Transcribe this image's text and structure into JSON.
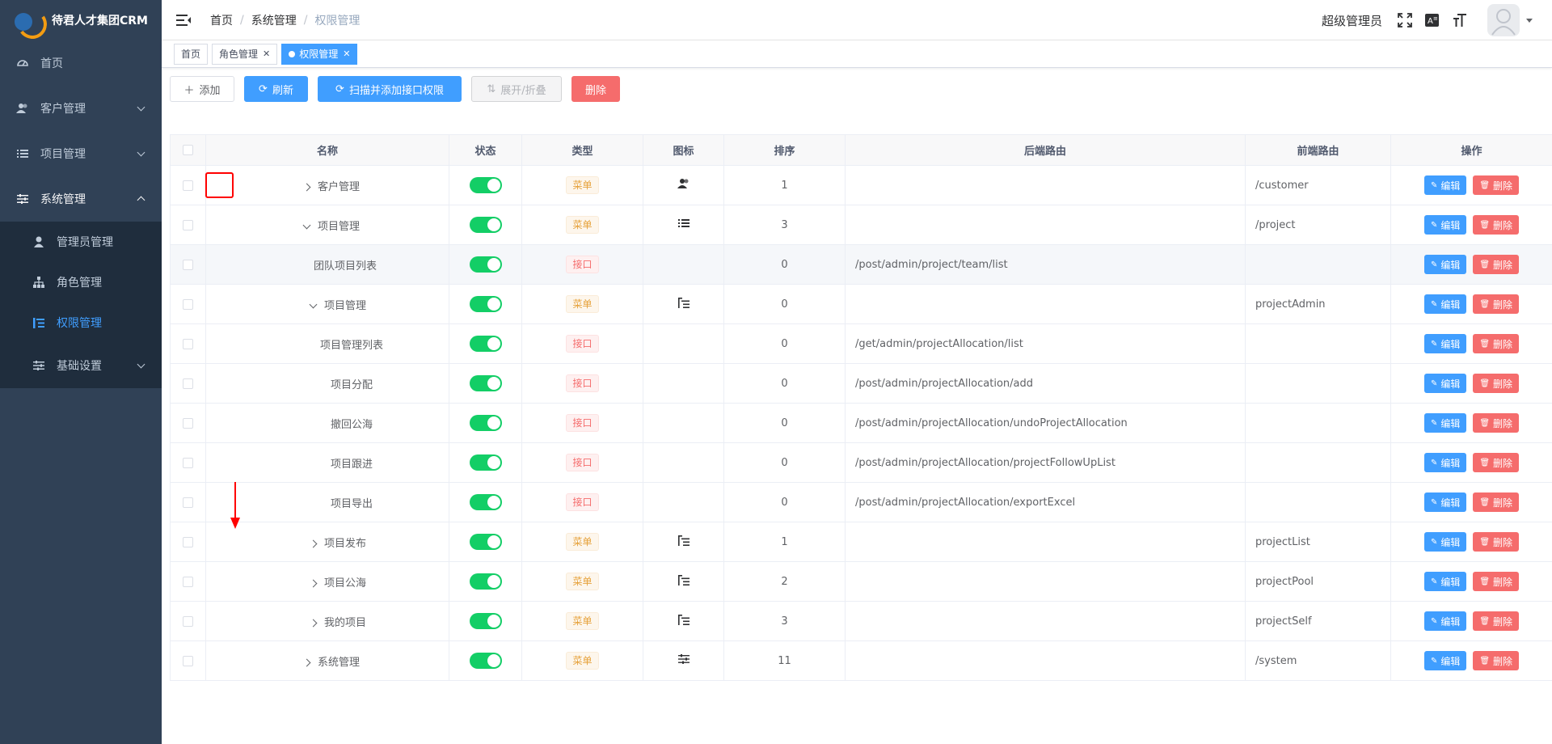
{
  "app": {
    "title": "待君人才集团CRM"
  },
  "sidebar": {
    "items": [
      {
        "label": "首页",
        "icon": "dashboard-icon"
      },
      {
        "label": "客户管理",
        "icon": "users-icon"
      },
      {
        "label": "项目管理",
        "icon": "list-icon"
      },
      {
        "label": "系统管理",
        "icon": "sliders-icon"
      }
    ],
    "submenu": [
      {
        "label": "管理员管理",
        "icon": "user-icon"
      },
      {
        "label": "角色管理",
        "icon": "sitemap-icon"
      },
      {
        "label": "权限管理",
        "icon": "tree-list-icon",
        "active": true
      },
      {
        "label": "基础设置",
        "icon": "sliders-icon"
      }
    ]
  },
  "header": {
    "breadcrumb": [
      "首页",
      "系统管理",
      "权限管理"
    ],
    "user": "超级管理员"
  },
  "tags": [
    {
      "label": "首页"
    },
    {
      "label": "角色管理"
    },
    {
      "label": "权限管理",
      "active": true
    }
  ],
  "toolbar": {
    "add": "添加",
    "refresh": "刷新",
    "scan": "扫描并添加接口权限",
    "expand": "展开/折叠",
    "delete": "删除"
  },
  "table": {
    "columns": [
      "名称",
      "状态",
      "类型",
      "图标",
      "排序",
      "后端路由",
      "前端路由",
      "操作"
    ],
    "edit_label": "编辑",
    "delete_label": "删除",
    "rows": [
      {
        "name": "客户管理",
        "level": 0,
        "expand": "closed",
        "type": "菜单",
        "icon": "users",
        "sort": "1",
        "backend": "",
        "frontend": "/customer"
      },
      {
        "name": "项目管理",
        "level": 0,
        "expand": "open",
        "type": "菜单",
        "icon": "list",
        "sort": "3",
        "backend": "",
        "frontend": "/project"
      },
      {
        "name": "团队项目列表",
        "level": 1,
        "expand": "none",
        "type": "接口",
        "icon": "",
        "sort": "0",
        "backend": "/post/admin/project/team/list",
        "frontend": "",
        "highlight": true
      },
      {
        "name": "项目管理",
        "level": 1,
        "expand": "open",
        "type": "菜单",
        "icon": "tree-list",
        "sort": "0",
        "backend": "",
        "frontend": "projectAdmin"
      },
      {
        "name": "项目管理列表",
        "level": 2,
        "expand": "none",
        "type": "接口",
        "icon": "",
        "sort": "0",
        "backend": "/get/admin/projectAllocation/list",
        "frontend": ""
      },
      {
        "name": "项目分配",
        "level": 2,
        "expand": "none",
        "type": "接口",
        "icon": "",
        "sort": "0",
        "backend": "/post/admin/projectAllocation/add",
        "frontend": ""
      },
      {
        "name": "撤回公海",
        "level": 2,
        "expand": "none",
        "type": "接口",
        "icon": "",
        "sort": "0",
        "backend": "/post/admin/projectAllocation/undoProjectAllocation",
        "frontend": ""
      },
      {
        "name": "项目跟进",
        "level": 2,
        "expand": "none",
        "type": "接口",
        "icon": "",
        "sort": "0",
        "backend": "/post/admin/projectAllocation/projectFollowUpList",
        "frontend": ""
      },
      {
        "name": "项目导出",
        "level": 2,
        "expand": "none",
        "type": "接口",
        "icon": "",
        "sort": "0",
        "backend": "/post/admin/projectAllocation/exportExcel",
        "frontend": ""
      },
      {
        "name": "项目发布",
        "level": 1,
        "expand": "closed",
        "type": "菜单",
        "icon": "tree-list",
        "sort": "1",
        "backend": "",
        "frontend": "projectList"
      },
      {
        "name": "项目公海",
        "level": 1,
        "expand": "closed",
        "type": "菜单",
        "icon": "tree-list",
        "sort": "2",
        "backend": "",
        "frontend": "projectPool"
      },
      {
        "name": "我的项目",
        "level": 1,
        "expand": "closed",
        "type": "菜单",
        "icon": "tree-list",
        "sort": "3",
        "backend": "",
        "frontend": "projectSelf"
      },
      {
        "name": "系统管理",
        "level": 0,
        "expand": "closed",
        "type": "菜单",
        "icon": "sliders",
        "sort": "11",
        "backend": "",
        "frontend": "/system"
      }
    ]
  }
}
